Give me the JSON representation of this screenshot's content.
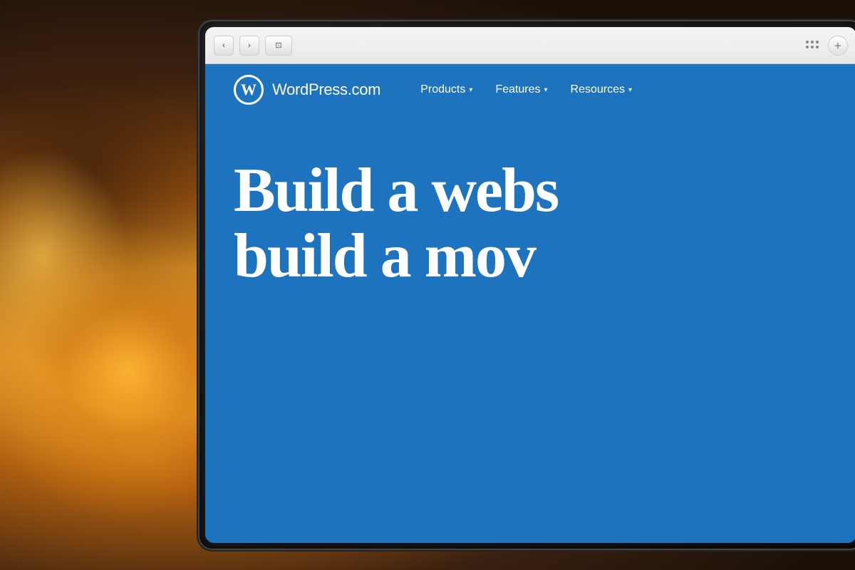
{
  "background": {
    "description": "Blurred warm bokeh background with orange/amber light"
  },
  "browser": {
    "back_button": "‹",
    "forward_button": "›",
    "sidebar_button": "⊡",
    "grid_button": "⠿",
    "add_tab_button": "+"
  },
  "website": {
    "logo_symbol": "W",
    "logo_text": "WordPress.com",
    "nav_items": [
      {
        "label": "Products",
        "has_dropdown": true
      },
      {
        "label": "Features",
        "has_dropdown": true
      },
      {
        "label": "Resources",
        "has_dropdown": true
      }
    ],
    "hero_line1": "Build a webs",
    "hero_line2": "build a mov"
  }
}
